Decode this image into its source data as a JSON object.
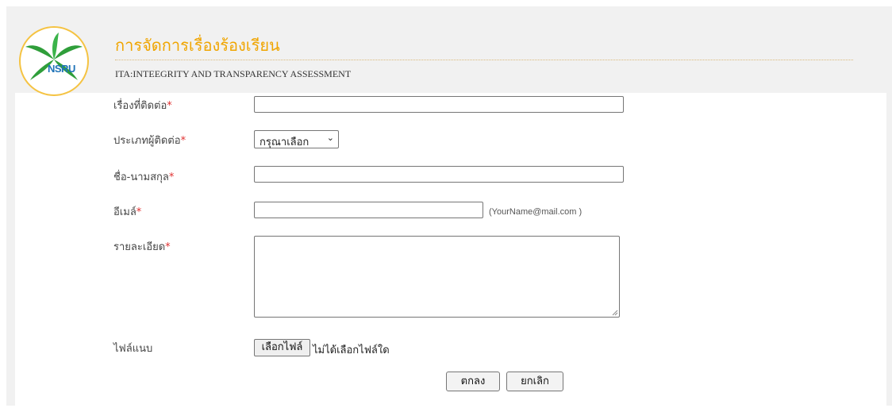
{
  "header": {
    "logo_text": "NSRU",
    "title": "การจัดการเรื่องร้องเรียน",
    "subtitle": "ITA:INTEEGRITY AND TRANSPARENCY ASSESSMENT"
  },
  "form": {
    "required_mark": "*",
    "subject_label": "เรื่องที่ติดต่อ",
    "subject_value": "",
    "contact_type_label": "ประเภทผู้ติดต่อ",
    "contact_type_selected": "กรุณาเลือก",
    "name_label": "ชื่อ-นามสกุล",
    "name_value": "",
    "email_label": "อีเมล์",
    "email_value": "",
    "email_hint": "(YourName@mail.com )",
    "detail_label": "รายละเอียด",
    "detail_value": "",
    "attachment_label": "ไฟล์แนบ",
    "choose_file_label": "เลือกไฟล์",
    "no_file_text": "ไม่ได้เลือกไฟล์ใด"
  },
  "actions": {
    "ok_label": "ตกลง",
    "cancel_label": "ยกเลิก"
  },
  "colors": {
    "title": "#f0a500",
    "required": "#e03030",
    "logo_border": "#f5c342",
    "logo_text": "#1f73b8",
    "frame_bg": "#f1f1f1"
  }
}
